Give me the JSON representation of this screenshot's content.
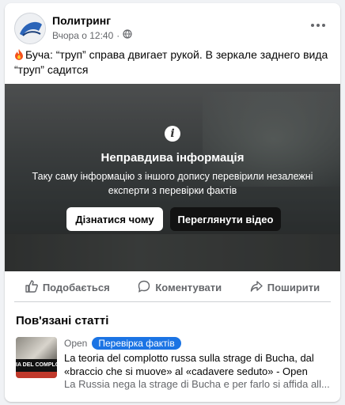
{
  "post": {
    "page_name": "Политринг",
    "time": "Вчора о 12:40",
    "separator": "·",
    "text": "Буча: “труп” справа двигает рукой. В зеркале заднего вида “труп” садится",
    "more_icon": "more-horizontal-icon"
  },
  "fact_check": {
    "title": "Неправдива інформація",
    "description": "Таку саму інформацію з іншого допису перевірили незалежні експерти з перевірки фактів",
    "why_button": "Дізнатися чому",
    "view_button": "Переглянути відео"
  },
  "actions": {
    "like": "Подобається",
    "comment": "Коментувати",
    "share": "Поширити"
  },
  "related": {
    "title": "Пов'язані статті",
    "article": {
      "source": "Open",
      "badge": "Перевірка фактів",
      "headline": "La teoria del complotto russa sulla strage di Bucha, dal «braccio che si muove» al «cadavere seduto» - Open",
      "snippet": "La Russia nega la strage di Bucha e per farlo si affida all...",
      "thumb_text": "IA DEL COMPLO"
    }
  },
  "colors": {
    "accent": "#1b74e4",
    "text_secondary": "#65676b",
    "background": "#f0f2f5"
  }
}
